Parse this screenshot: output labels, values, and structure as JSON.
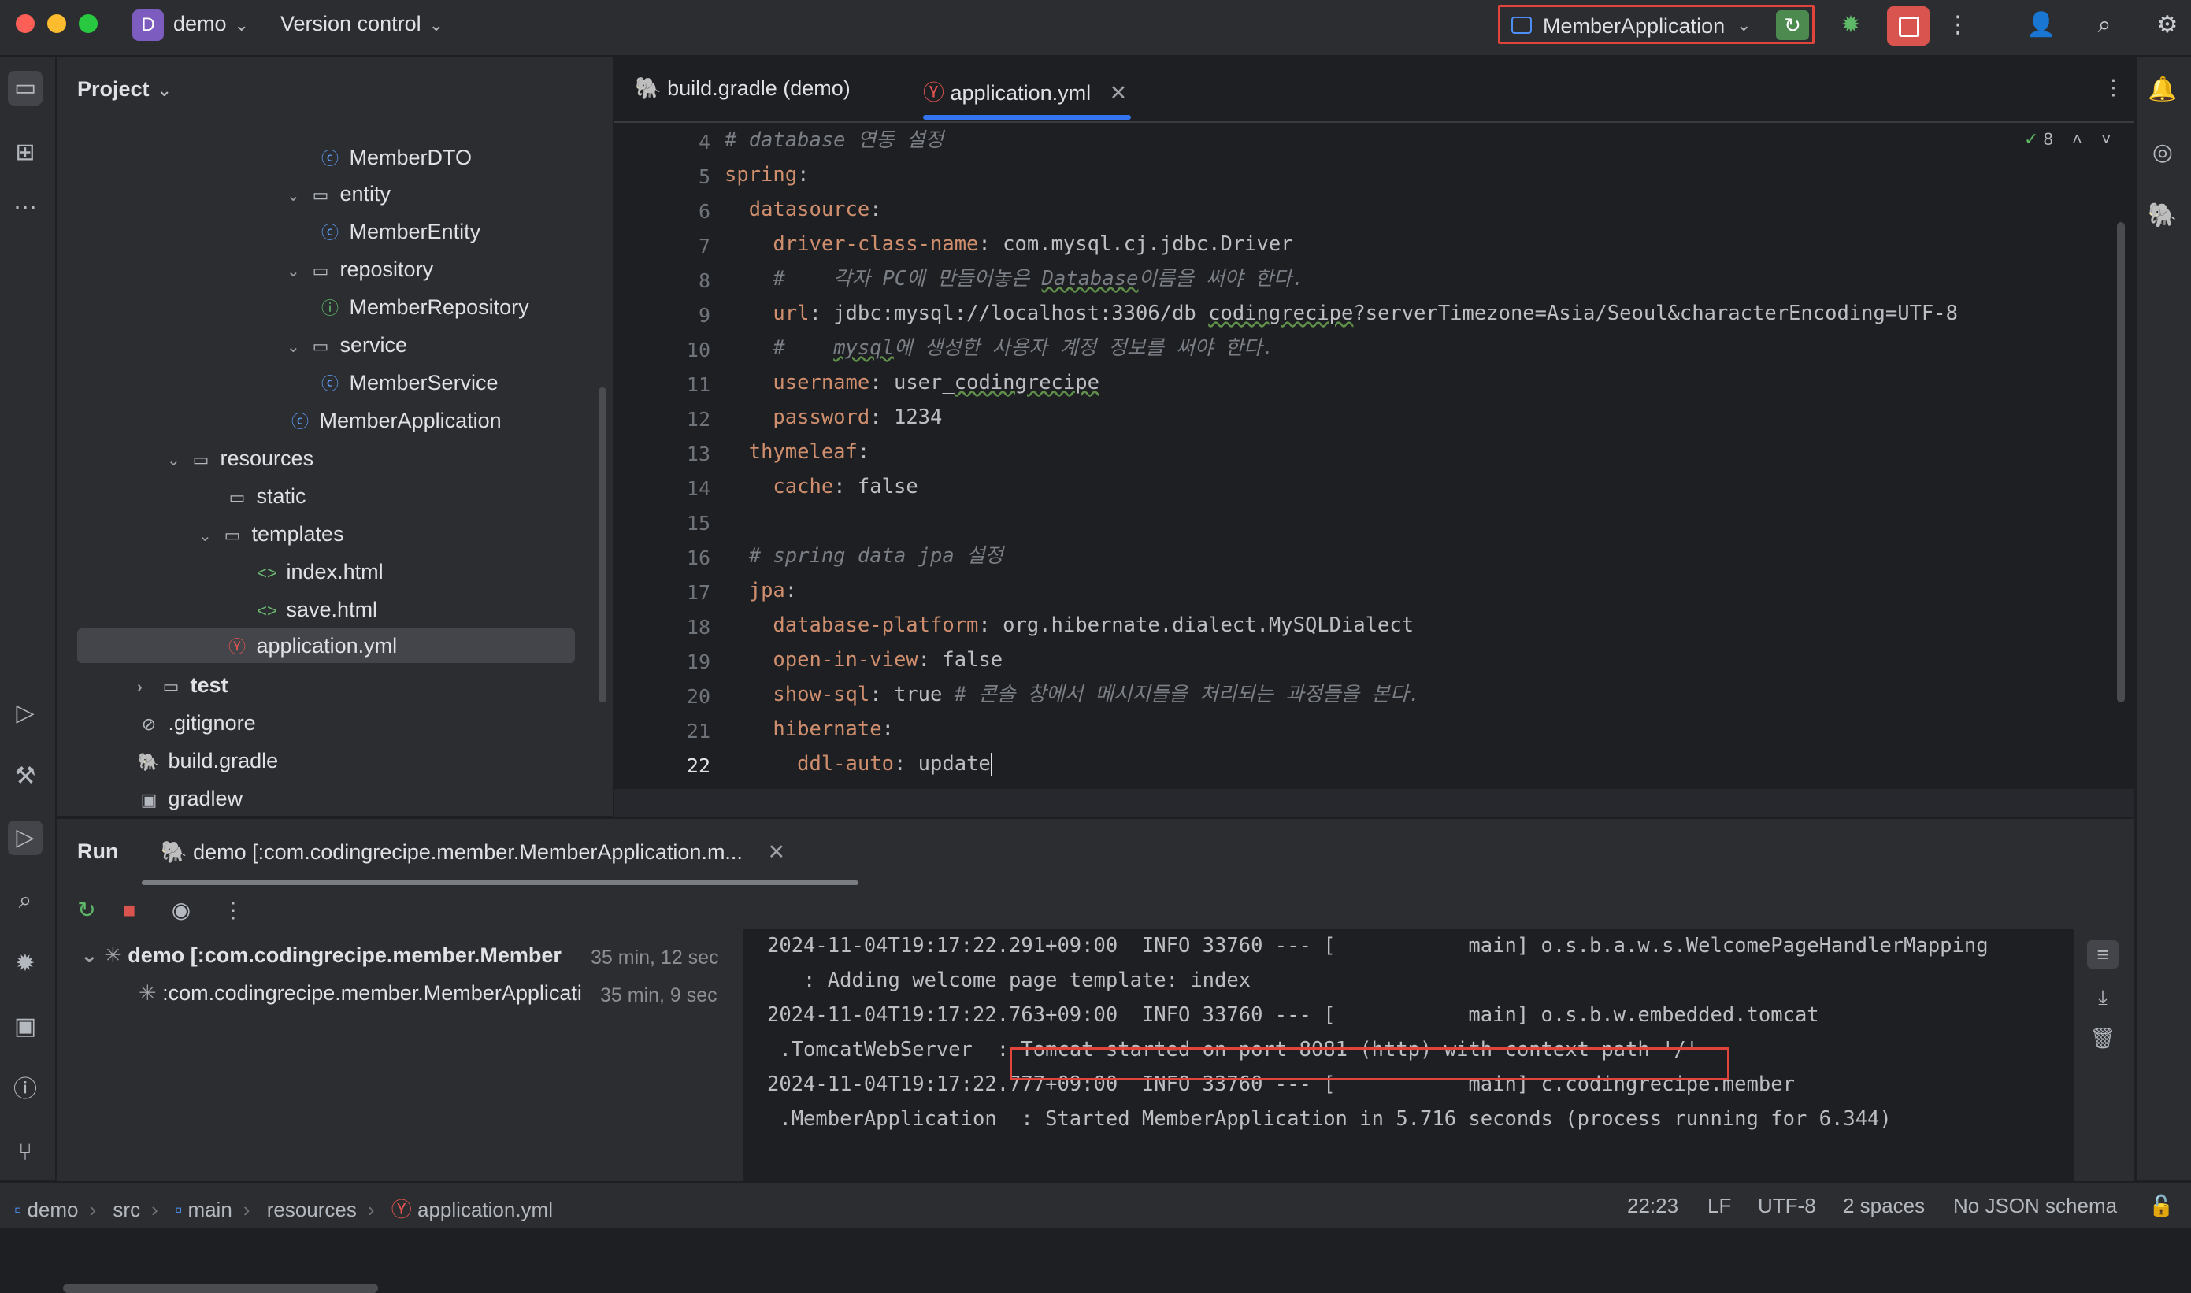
{
  "titlebar": {
    "project_badge": "D",
    "project_name": "demo",
    "vcs_label": "Version control",
    "run_config": "MemberApplication"
  },
  "project_panel": {
    "title": "Project",
    "items": [
      {
        "label": "MemberDTO",
        "kind": "class"
      },
      {
        "label": "entity",
        "kind": "package"
      },
      {
        "label": "MemberEntity",
        "kind": "class"
      },
      {
        "label": "repository",
        "kind": "package"
      },
      {
        "label": "MemberRepository",
        "kind": "interface"
      },
      {
        "label": "service",
        "kind": "package"
      },
      {
        "label": "MemberService",
        "kind": "class"
      },
      {
        "label": "MemberApplication",
        "kind": "spring-class"
      },
      {
        "label": "resources",
        "kind": "resource-folder"
      },
      {
        "label": "static",
        "kind": "folder"
      },
      {
        "label": "templates",
        "kind": "folder"
      },
      {
        "label": "index.html",
        "kind": "html"
      },
      {
        "label": "save.html",
        "kind": "html"
      },
      {
        "label": "application.yml",
        "kind": "yml",
        "selected": true
      },
      {
        "label": "test",
        "kind": "test-folder"
      },
      {
        "label": ".gitignore",
        "kind": "ignore"
      },
      {
        "label": "build.gradle",
        "kind": "gradle"
      },
      {
        "label": "gradlew",
        "kind": "script"
      }
    ]
  },
  "editor": {
    "tabs": [
      {
        "label": "build.gradle (demo)",
        "active": false
      },
      {
        "label": "application.yml",
        "active": true
      }
    ],
    "inspection_count": "8",
    "line_numbers": [
      "4",
      "5",
      "6",
      "7",
      "8",
      "9",
      "10",
      "11",
      "12",
      "13",
      "14",
      "15",
      "16",
      "17",
      "18",
      "19",
      "20",
      "21",
      "22"
    ],
    "lines": {
      "l4": "# database 연동 설정",
      "l5_key": "spring",
      "l6_key": "datasource",
      "l7_key": "driver-class-name",
      "l7_val": "com.mysql.cj.jdbc.Driver",
      "l8_a": "#    각자 PC에 만들어놓은 ",
      "l8_b": "Database",
      "l8_c": "이름을 써야 한다.",
      "l9_key": "url",
      "l9_a": "jdbc:mysql://localhost:3306/db_",
      "l9_b": "codingrecipe",
      "l9_c": "?serverTimezone=Asia/Seoul&characterEncoding=UTF-8",
      "l10_a": "#    ",
      "l10_b": "mysql",
      "l10_c": "에 생성한 사용자 계정 정보를 써야 한다.",
      "l11_key": "username",
      "l11_a": "user_",
      "l11_b": "codingrecipe",
      "l12_key": "password",
      "l12_val": "1234",
      "l13_key": "thymeleaf",
      "l14_key": "cache",
      "l14_val": "false",
      "l16": "# spring data jpa 설정",
      "l17_key": "jpa",
      "l18_key": "database-platform",
      "l18_val": "org.hibernate.dialect.MySQLDialect",
      "l19_key": "open-in-view",
      "l19_val": "false",
      "l20_key": "show-sql",
      "l20_val": "true",
      "l20_comment": "# 콘솔 창에서 메시지들을 처리되는 과정들을 본다.",
      "l21_key": "hibernate",
      "l22_key": "ddl-auto",
      "l22_val": "update"
    }
  },
  "run_panel": {
    "title": "Run",
    "tab_label": "demo [:com.codingrecipe.member.MemberApplication.m...",
    "tree": [
      {
        "label": "demo [:com.codingrecipe.member.Member",
        "time": "35 min, 12 sec"
      },
      {
        "label": ":com.codingrecipe.member.MemberApplicati",
        "time": "35 min, 9 sec"
      }
    ],
    "log": {
      "line1": "2024-11-04T19:17:22.291+09:00  INFO 33760 --- [           main] o.s.b.a.w.s.WelcomePageHandlerMapping",
      "line2": "   : Adding welcome page template: index",
      "line3": "2024-11-04T19:17:22.763+09:00  INFO 33760 --- [           main] o.s.b.w.embedded.tomcat",
      "line4_a": " .TomcatWebServer  : ",
      "line4_b": "Tomcat started on port 8081 (http) with context path '/'",
      "line5": "2024-11-04T19:17:22.777+09:00  INFO 33760 --- [           main] c.codingrecipe.member",
      "line6": " .MemberApplication  : Started MemberApplication in 5.716 seconds (process running for 6.344)"
    }
  },
  "statusbar": {
    "breadcrumbs": [
      "demo",
      "src",
      "main",
      "resources",
      "application.yml"
    ],
    "position": "22:23",
    "line_sep": "LF",
    "encoding": "UTF-8",
    "indent": "2 spaces",
    "schema": "No JSON schema"
  },
  "colors": {
    "accent": "#3574f0",
    "highlight_border": "#e0443a",
    "run_green": "#4c8a4f",
    "stop_red": "#d9534f",
    "yaml_key": "#cf8e6d",
    "comment": "#7a7e85"
  },
  "icons": [
    "folder-icon",
    "structure-icon",
    "more-icon",
    "services-icon",
    "build-icon",
    "run-icon",
    "search-icon",
    "debug-icon",
    "terminal-icon",
    "problems-icon",
    "git-icon",
    "notifications-icon",
    "ai-icon",
    "gradle-icon",
    "add-user-icon",
    "settings-icon",
    "rerun-icon",
    "stop-icon",
    "eye-icon"
  ]
}
